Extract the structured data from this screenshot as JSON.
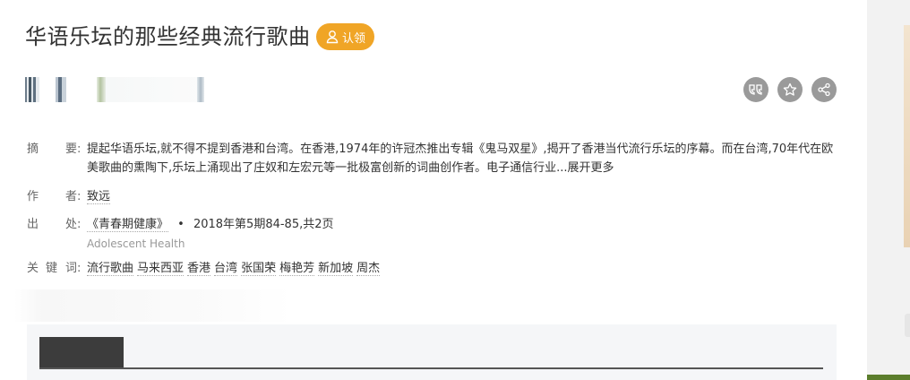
{
  "title": "华语乐坛的那些经典流行歌曲",
  "claim_label": "认领",
  "meta": {
    "abstract_label": [
      "摘",
      "要:"
    ],
    "abstract_text": "提起华语乐坛,就不得不提到香港和台湾。在香港,1974年的许冠杰推出专辑《鬼马双星》,揭开了香港当代流行乐坛的序幕。而在台湾,70年代在欧美歌曲的熏陶下,乐坛上涌现出了庄奴和左宏元等一批极富创新的词曲创作者。电子通信行业...",
    "expand_label": "展开更多",
    "author_label": [
      "作",
      "者:"
    ],
    "author": "致远",
    "source_label": [
      "出",
      "处:"
    ],
    "source_journal": "《青春期健康》",
    "source_sep": "•",
    "source_issue": "2018年第5期84-85,共2页",
    "source_english": "Adolescent Health",
    "keywords_label": [
      "关",
      "键",
      "词:"
    ],
    "keywords": [
      "流行歌曲",
      "马来西亚",
      "香港",
      "台湾",
      "张国荣",
      "梅艳芳",
      "新加坡",
      "周杰"
    ]
  },
  "actions": [
    "quote-icon",
    "star-icon",
    "share-icon"
  ],
  "colors": {
    "claim": "#f0a526",
    "action_bg": "#9a9a9a",
    "tab_active": "#3c3c3c"
  }
}
